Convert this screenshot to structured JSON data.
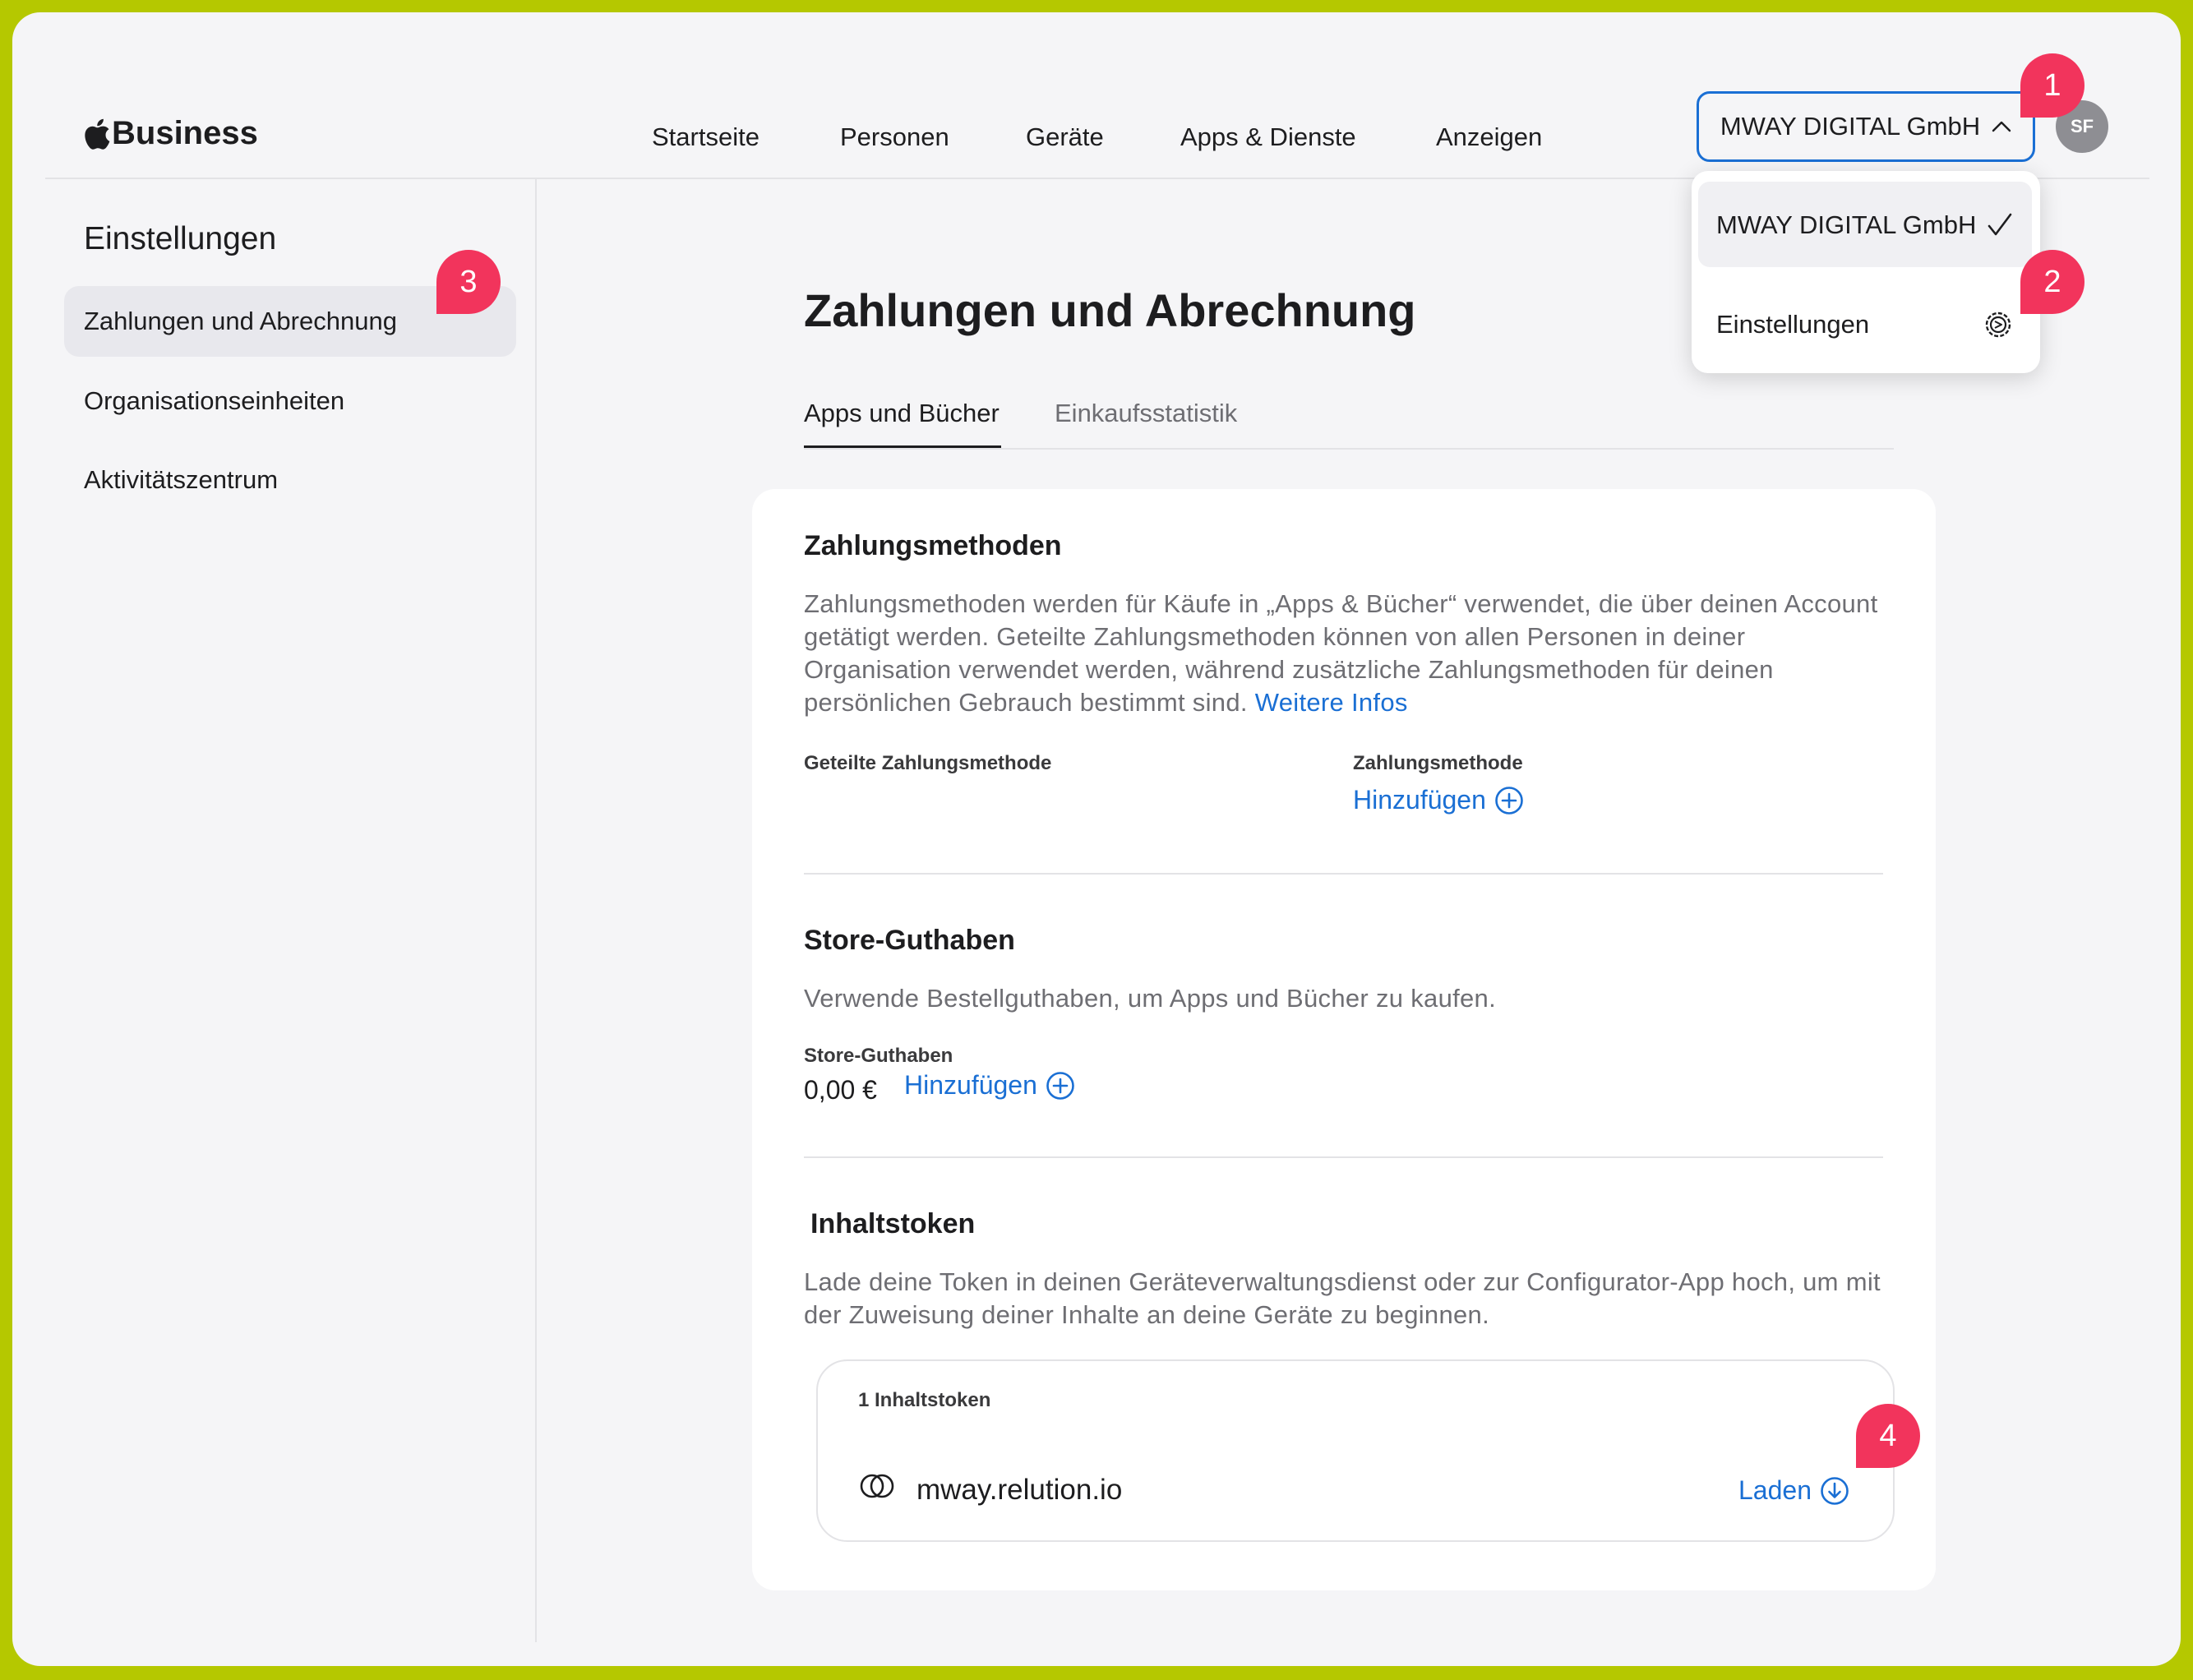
{
  "header": {
    "brand": "Business",
    "nav": [
      "Startseite",
      "Personen",
      "Geräte",
      "Apps & Dienste",
      "Anzeigen"
    ],
    "org_selector": "MWAY DIGITAL GmbH",
    "avatar_initials": "SF"
  },
  "org_menu": {
    "items": [
      {
        "label": "MWAY DIGITAL GmbH",
        "icon": "checkmark-icon"
      },
      {
        "label": "Einstellungen",
        "icon": "gear-icon"
      }
    ]
  },
  "sidebar": {
    "title": "Einstellungen",
    "items": [
      "Zahlungen und Abrechnung",
      "Organisationseinheiten",
      "Aktivitätszentrum"
    ]
  },
  "main": {
    "title": "Zahlungen und Abrechnung",
    "tabs": [
      "Apps und Bücher",
      "Einkaufsstatistik"
    ],
    "payment": {
      "title": "Zahlungsmethoden",
      "description": "Zahlungsmethoden werden für Käufe in „Apps & Bücher“ verwendet, die über deinen Account getätigt werden. Geteilte Zahlungsmethoden können von allen Personen in deiner Organisation verwendet werden, während zusätzliche Zahlungsmethoden für deinen persönlichen Gebrauch bestimmt sind.",
      "more_link": "Weitere Infos",
      "shared_label": "Geteilte Zahlungsmethode",
      "method_label": "Zahlungsmethode",
      "add_label": "Hinzufügen"
    },
    "store_credit": {
      "title": "Store-Guthaben",
      "description": "Verwende Bestellguthaben, um Apps und Bücher zu kaufen.",
      "label": "Store-Guthaben",
      "amount": "0,00 €",
      "add_label": "Hinzufügen"
    },
    "tokens": {
      "title": "Inhaltstoken",
      "description": "Lade deine Token in deinen Geräteverwaltungsdienst oder zur Configurator-App hoch, um mit der Zuweisung deiner Inhalte an deine Geräte zu beginnen.",
      "count_label": "1 Inhaltstoken",
      "token_name": "mway.relution.io",
      "download_label": "Laden"
    }
  },
  "markers": [
    "1",
    "2",
    "3",
    "4"
  ],
  "colors": {
    "accent": "#1a6fd4",
    "marker": "#f2345c",
    "frame_border": "#b5c800"
  }
}
